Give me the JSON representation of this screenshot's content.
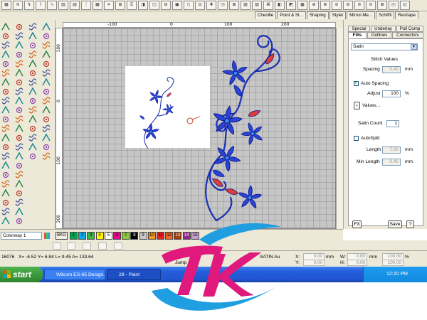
{
  "ruler": {
    "h_labels": [
      "-100",
      "0",
      "100",
      "200"
    ],
    "v_labels": [
      "100",
      "0",
      "100",
      "200"
    ]
  },
  "object_tabs": [
    "Chenille",
    "Point & St...",
    "Shaping",
    "Stylet",
    "Mirror-Me...",
    "Schiffli",
    "Reshape"
  ],
  "panel": {
    "tabs_row1": [
      "Special",
      "Underlay",
      "Pull Comp"
    ],
    "tabs_row2": [
      "Fills",
      "Outlines",
      "Connectors"
    ],
    "fill_type": "Satin",
    "stitch_values_label": "Stitch Values",
    "spacing_label": "Spacing",
    "spacing_value": "0.40",
    "spacing_unit": "mm",
    "auto_spacing_label": "Auto Spacing",
    "adjust_label": "Adjust",
    "adjust_value": "100",
    "adjust_unit": "%",
    "values_button": "Values...",
    "satin_count_label": "Satin Count",
    "satin_count_value": "1",
    "autosplit_label": "AutoSplit",
    "length_label": "Length",
    "length_value": "7.00",
    "length_unit": "mm",
    "min_length_label": "Min Length",
    "min_length_value": "0.40",
    "min_length_unit": "mm",
    "fx_button": "FX",
    "save_button": "Save",
    "help_button": "?"
  },
  "colorway": {
    "label": "Colorway 1",
    "bkg_label": "BKG",
    "swatches": [
      {
        "num": "1",
        "color": "#00a651"
      },
      {
        "num": "2",
        "color": "#00aeef"
      },
      {
        "num": "3",
        "color": "#39b54a"
      },
      {
        "num": "4",
        "color": "#fff200"
      },
      {
        "num": "5",
        "color": "#ffffff"
      },
      {
        "num": "6",
        "color": "#ec008c"
      },
      {
        "num": "7",
        "color": "#8dc63f"
      },
      {
        "num": "8",
        "color": "#000000"
      },
      {
        "num": "9",
        "color": "#c8c8c8"
      },
      {
        "num": "10",
        "color": "#f7941d"
      },
      {
        "num": "11",
        "color": "#ed1c24"
      },
      {
        "num": "12",
        "color": "#f26522"
      },
      {
        "num": "13",
        "color": "#a0410d"
      },
      {
        "num": "14",
        "color": "#92278f"
      },
      {
        "num": "15",
        "color": "#c2a0c8"
      }
    ]
  },
  "status": {
    "stitch_count": "16076",
    "coords": "X= -6.52 Y= 6.84 L= 9.45 A= 133.64",
    "object_type": "SATIN Au",
    "x_label": "X:",
    "x_value": "0.00",
    "y_label": "Y:",
    "y_value": "0.00",
    "w_label": "W:",
    "w_value": "0.00",
    "h_label": "H:",
    "h_value": "0.00",
    "mm_unit": "mm",
    "pct1": "100.00",
    "pct2": "100.00",
    "pct_unit": "%",
    "jump_text": "Jump"
  },
  "taskbar": {
    "start": "start",
    "tasks": [
      "Wilcom ES-65 Design...",
      "29 - Paint"
    ],
    "clock": "12:20 PM"
  },
  "colors": {
    "flower_blue": "#2b44d6",
    "flower_outline": "#0b1a8f",
    "flower_red": "#e23b35",
    "logo_pink": "#e0197d",
    "logo_blue": "#1f9ee0"
  }
}
